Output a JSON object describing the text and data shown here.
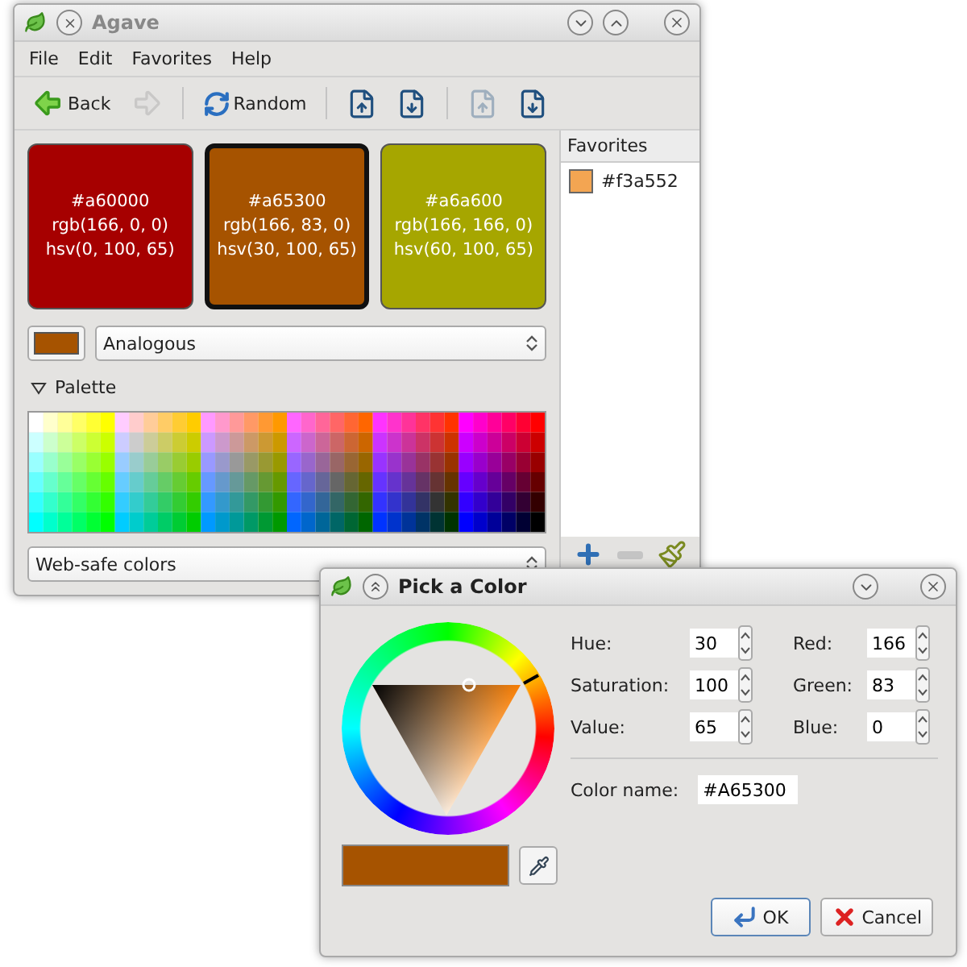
{
  "main_window": {
    "title": "Agave",
    "menu": [
      {
        "label": "File"
      },
      {
        "label": "Edit"
      },
      {
        "label": "Favorites"
      },
      {
        "label": "Help"
      }
    ],
    "toolbar": [
      {
        "kind": "back",
        "label": "Back",
        "disabled": false
      },
      {
        "kind": "forward",
        "disabled": true
      },
      {
        "kind": "separator"
      },
      {
        "kind": "random",
        "label": "Random",
        "disabled": false
      },
      {
        "kind": "separator"
      },
      {
        "kind": "lighten",
        "disabled": false
      },
      {
        "kind": "darken",
        "disabled": false
      },
      {
        "kind": "separator"
      },
      {
        "kind": "saturate",
        "disabled": true
      },
      {
        "kind": "desaturate",
        "disabled": false
      }
    ],
    "swatches": [
      {
        "hex": "#a60000",
        "rgb": "rgb(166, 0, 0)",
        "hsv": "hsv(0, 100, 65)",
        "color": "#a60000",
        "selected": false
      },
      {
        "hex": "#a65300",
        "rgb": "rgb(166, 83, 0)",
        "hsv": "hsv(30, 100, 65)",
        "color": "#a65300",
        "selected": true
      },
      {
        "hex": "#a6a600",
        "rgb": "rgb(166, 166, 0)",
        "hsv": "hsv(60, 100, 65)",
        "color": "#a6a600",
        "selected": false
      }
    ],
    "current_swatch": {
      "color": "#a65300"
    },
    "scheme": "Analogous",
    "palette": {
      "label": "Palette",
      "expanded": true,
      "source": "Web-safe colors"
    },
    "favorites": {
      "title": "Favorites",
      "items": [
        {
          "label": "#f3a552",
          "color": "#f3a552"
        }
      ]
    }
  },
  "dialog": {
    "title": "Pick a Color",
    "fields": [
      {
        "label": "Hue:",
        "value": "30"
      },
      {
        "label": "Red:",
        "value": "166"
      },
      {
        "label": "Saturation:",
        "value": "100"
      },
      {
        "label": "Green:",
        "value": "83"
      },
      {
        "label": "Value:",
        "value": "65"
      },
      {
        "label": "Blue:",
        "value": "0"
      }
    ],
    "color_name_label": "Color name:",
    "color_name": "#A65300",
    "preview": {
      "color": "#a65300"
    },
    "buttons": [
      {
        "kind": "ok",
        "label": "OK",
        "selected": true
      },
      {
        "kind": "cancel",
        "label": "Cancel",
        "selected": false
      }
    ]
  }
}
